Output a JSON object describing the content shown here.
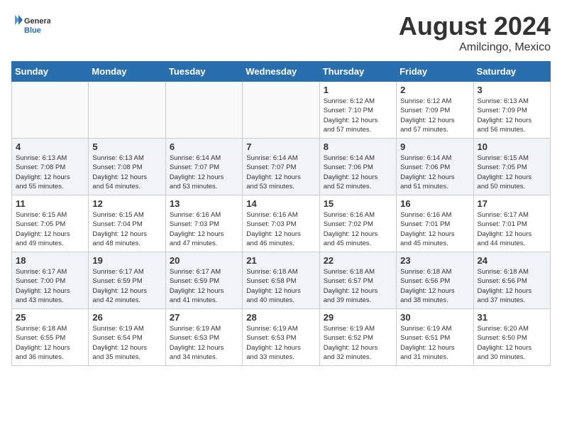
{
  "header": {
    "logo_general": "General",
    "logo_blue": "Blue",
    "month_year": "August 2024",
    "location": "Amilcingo, Mexico"
  },
  "weekdays": [
    "Sunday",
    "Monday",
    "Tuesday",
    "Wednesday",
    "Thursday",
    "Friday",
    "Saturday"
  ],
  "weeks": [
    [
      {
        "day": "",
        "info": ""
      },
      {
        "day": "",
        "info": ""
      },
      {
        "day": "",
        "info": ""
      },
      {
        "day": "",
        "info": ""
      },
      {
        "day": "1",
        "info": "Sunrise: 6:12 AM\nSunset: 7:10 PM\nDaylight: 12 hours\nand 57 minutes."
      },
      {
        "day": "2",
        "info": "Sunrise: 6:12 AM\nSunset: 7:09 PM\nDaylight: 12 hours\nand 57 minutes."
      },
      {
        "day": "3",
        "info": "Sunrise: 6:13 AM\nSunset: 7:09 PM\nDaylight: 12 hours\nand 56 minutes."
      }
    ],
    [
      {
        "day": "4",
        "info": "Sunrise: 6:13 AM\nSunset: 7:08 PM\nDaylight: 12 hours\nand 55 minutes."
      },
      {
        "day": "5",
        "info": "Sunrise: 6:13 AM\nSunset: 7:08 PM\nDaylight: 12 hours\nand 54 minutes."
      },
      {
        "day": "6",
        "info": "Sunrise: 6:14 AM\nSunset: 7:07 PM\nDaylight: 12 hours\nand 53 minutes."
      },
      {
        "day": "7",
        "info": "Sunrise: 6:14 AM\nSunset: 7:07 PM\nDaylight: 12 hours\nand 53 minutes."
      },
      {
        "day": "8",
        "info": "Sunrise: 6:14 AM\nSunset: 7:06 PM\nDaylight: 12 hours\nand 52 minutes."
      },
      {
        "day": "9",
        "info": "Sunrise: 6:14 AM\nSunset: 7:06 PM\nDaylight: 12 hours\nand 51 minutes."
      },
      {
        "day": "10",
        "info": "Sunrise: 6:15 AM\nSunset: 7:05 PM\nDaylight: 12 hours\nand 50 minutes."
      }
    ],
    [
      {
        "day": "11",
        "info": "Sunrise: 6:15 AM\nSunset: 7:05 PM\nDaylight: 12 hours\nand 49 minutes."
      },
      {
        "day": "12",
        "info": "Sunrise: 6:15 AM\nSunset: 7:04 PM\nDaylight: 12 hours\nand 48 minutes."
      },
      {
        "day": "13",
        "info": "Sunrise: 6:16 AM\nSunset: 7:03 PM\nDaylight: 12 hours\nand 47 minutes."
      },
      {
        "day": "14",
        "info": "Sunrise: 6:16 AM\nSunset: 7:03 PM\nDaylight: 12 hours\nand 46 minutes."
      },
      {
        "day": "15",
        "info": "Sunrise: 6:16 AM\nSunset: 7:02 PM\nDaylight: 12 hours\nand 45 minutes."
      },
      {
        "day": "16",
        "info": "Sunrise: 6:16 AM\nSunset: 7:01 PM\nDaylight: 12 hours\nand 45 minutes."
      },
      {
        "day": "17",
        "info": "Sunrise: 6:17 AM\nSunset: 7:01 PM\nDaylight: 12 hours\nand 44 minutes."
      }
    ],
    [
      {
        "day": "18",
        "info": "Sunrise: 6:17 AM\nSunset: 7:00 PM\nDaylight: 12 hours\nand 43 minutes."
      },
      {
        "day": "19",
        "info": "Sunrise: 6:17 AM\nSunset: 6:59 PM\nDaylight: 12 hours\nand 42 minutes."
      },
      {
        "day": "20",
        "info": "Sunrise: 6:17 AM\nSunset: 6:59 PM\nDaylight: 12 hours\nand 41 minutes."
      },
      {
        "day": "21",
        "info": "Sunrise: 6:18 AM\nSunset: 6:58 PM\nDaylight: 12 hours\nand 40 minutes."
      },
      {
        "day": "22",
        "info": "Sunrise: 6:18 AM\nSunset: 6:57 PM\nDaylight: 12 hours\nand 39 minutes."
      },
      {
        "day": "23",
        "info": "Sunrise: 6:18 AM\nSunset: 6:56 PM\nDaylight: 12 hours\nand 38 minutes."
      },
      {
        "day": "24",
        "info": "Sunrise: 6:18 AM\nSunset: 6:56 PM\nDaylight: 12 hours\nand 37 minutes."
      }
    ],
    [
      {
        "day": "25",
        "info": "Sunrise: 6:18 AM\nSunset: 6:55 PM\nDaylight: 12 hours\nand 36 minutes."
      },
      {
        "day": "26",
        "info": "Sunrise: 6:19 AM\nSunset: 6:54 PM\nDaylight: 12 hours\nand 35 minutes."
      },
      {
        "day": "27",
        "info": "Sunrise: 6:19 AM\nSunset: 6:53 PM\nDaylight: 12 hours\nand 34 minutes."
      },
      {
        "day": "28",
        "info": "Sunrise: 6:19 AM\nSunset: 6:53 PM\nDaylight: 12 hours\nand 33 minutes."
      },
      {
        "day": "29",
        "info": "Sunrise: 6:19 AM\nSunset: 6:52 PM\nDaylight: 12 hours\nand 32 minutes."
      },
      {
        "day": "30",
        "info": "Sunrise: 6:19 AM\nSunset: 6:51 PM\nDaylight: 12 hours\nand 31 minutes."
      },
      {
        "day": "31",
        "info": "Sunrise: 6:20 AM\nSunset: 6:50 PM\nDaylight: 12 hours\nand 30 minutes."
      }
    ]
  ]
}
